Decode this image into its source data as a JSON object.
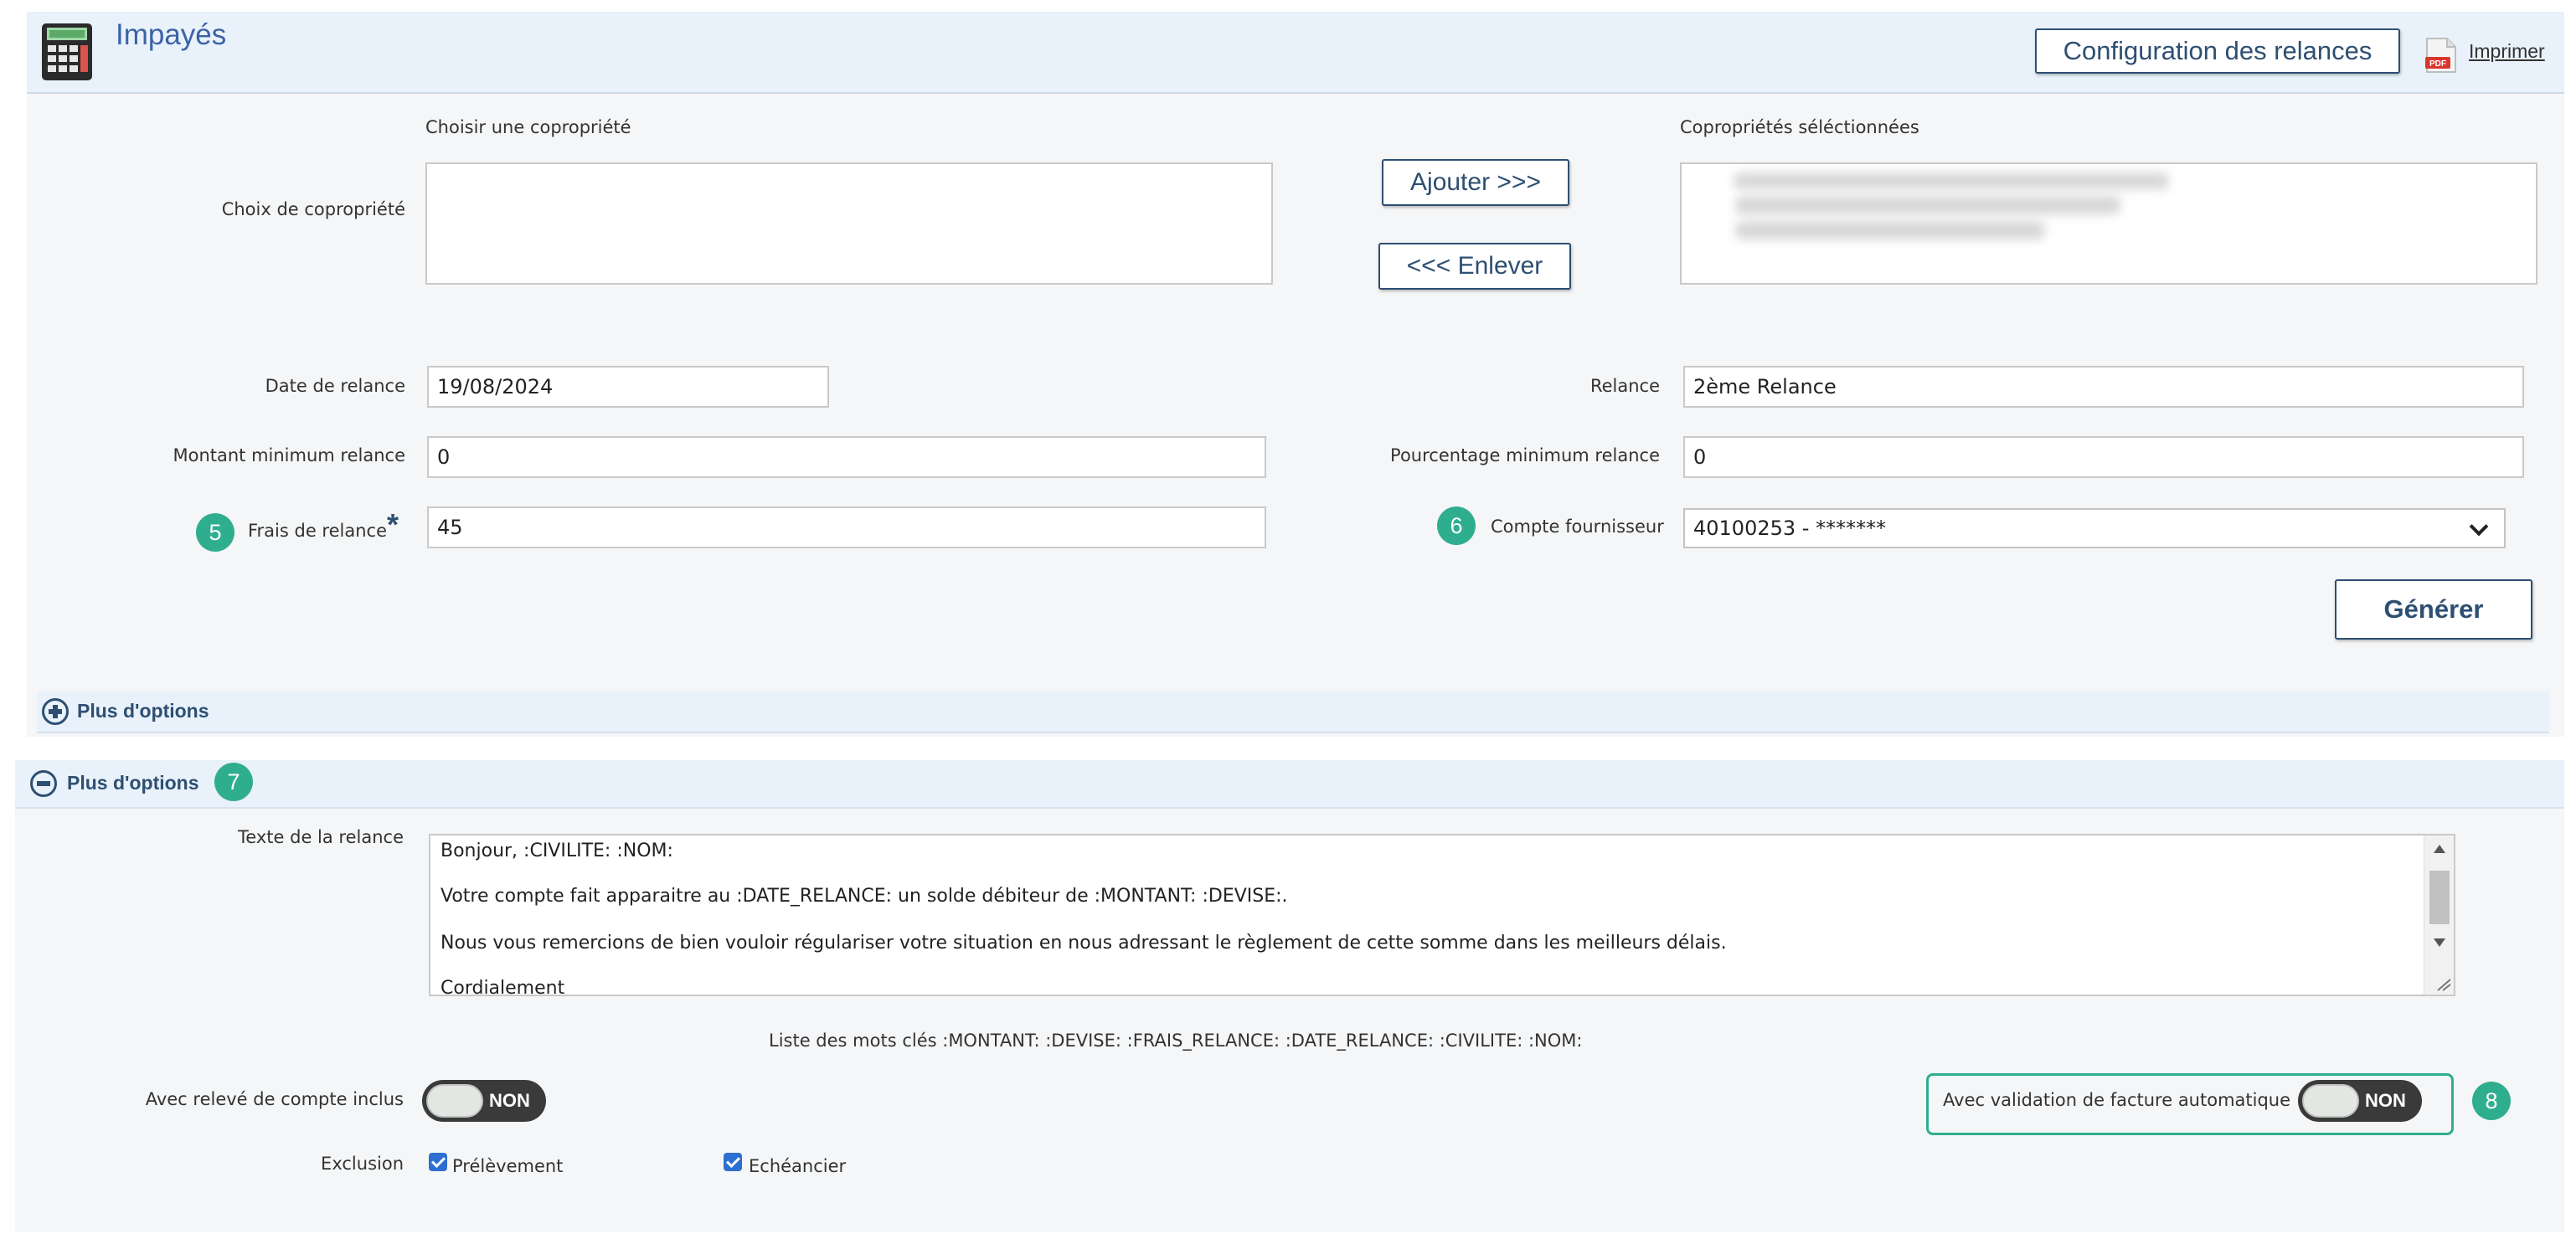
{
  "header": {
    "title": "Impayés",
    "config_button": "Configuration des relances",
    "print_link": "Imprimer",
    "pdf_badge": "PDF"
  },
  "copro": {
    "choose_label": "Choisir une copropriété",
    "selected_label": "Copropriétés séléctionnées",
    "row_label": "Choix de copropriété",
    "add_button": "Ajouter >>>",
    "remove_button": "<<< Enlever"
  },
  "form": {
    "date_label": "Date de relance",
    "date_value": "19/08/2024",
    "relance_label": "Relance",
    "relance_value": "2ème Relance",
    "montant_label": "Montant minimum relance",
    "montant_value": "0",
    "pourcentage_label": "Pourcentage minimum relance",
    "pourcentage_value": "0",
    "frais_label": "Frais de relance",
    "frais_required": "*",
    "frais_value": "45",
    "compte_label": "Compte fournisseur",
    "compte_value": "40100253 - *******",
    "generate_button": "Générer"
  },
  "badges": {
    "b5": "5",
    "b6": "6",
    "b7": "7",
    "b8": "8"
  },
  "options": {
    "collapsed_label": "Plus d'options",
    "expanded_label": "Plus d'options"
  },
  "relance_text": {
    "label": "Texte de la relance",
    "lines": [
      "Bonjour, :CIVILITE: :NOM:",
      "Votre compte fait apparaitre au :DATE_RELANCE: un solde débiteur de :MONTANT: :DEVISE:.",
      "Nous vous remercions de bien vouloir régulariser votre situation en nous adressant le règlement de cette somme dans les meilleurs délais.",
      "Cordialement"
    ],
    "keywords": "Liste des mots clés :MONTANT: :DEVISE: :FRAIS_RELANCE: :DATE_RELANCE: :CIVILITE: :NOM:"
  },
  "toggles": {
    "releve_label": "Avec relevé de compte inclus",
    "releve_state": "NON",
    "validation_label": "Avec validation de facture automatique",
    "validation_state": "NON"
  },
  "exclusion": {
    "label": "Exclusion",
    "prelevement": "Prélèvement",
    "echeancier": "Echéancier",
    "prelevement_checked": true,
    "echeancier_checked": true
  },
  "colors": {
    "title_blue": "#3c63a6",
    "button_border": "#2d4f72",
    "badge_green": "#2fae8f",
    "header_bg": "#e9f1fa",
    "panel_bg": "#f5f6f7"
  }
}
